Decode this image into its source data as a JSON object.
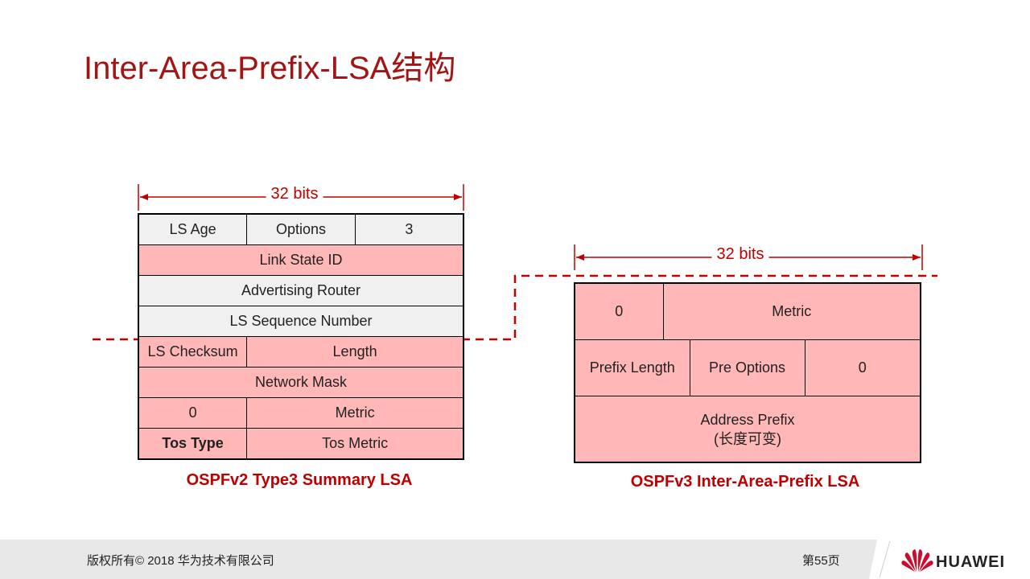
{
  "title": "Inter-Area-Prefix-LSA结构",
  "left_diagram": {
    "width_label": "32 bits",
    "rows": [
      [
        "LS Age",
        "Options",
        "3"
      ],
      [
        "Link State ID"
      ],
      [
        "Advertising Router"
      ],
      [
        "LS Sequence Number"
      ],
      [
        "LS Checksum",
        "Length"
      ],
      [
        "Network Mask"
      ],
      [
        "0",
        "Metric"
      ],
      [
        "Tos Type",
        "Tos Metric"
      ]
    ],
    "caption": "OSPFv2 Type3 Summary LSA"
  },
  "right_diagram": {
    "width_label": "32 bits",
    "rows": [
      [
        "0",
        "Metric"
      ],
      [
        "Prefix Length",
        "Pre Options",
        "0"
      ],
      [
        "Address Prefix",
        "(长度可变)"
      ]
    ],
    "caption": "OSPFv3 Inter-Area-Prefix LSA"
  },
  "colors": {
    "title": "#a31515",
    "highlight_fill": "#ffb7b7",
    "header_fill": "#f0f0f0",
    "accent": "#c00000"
  },
  "footer": {
    "copyright": "版权所有© 2018 华为技术有限公司",
    "page": "第55页",
    "brand": "HUAWEI"
  }
}
